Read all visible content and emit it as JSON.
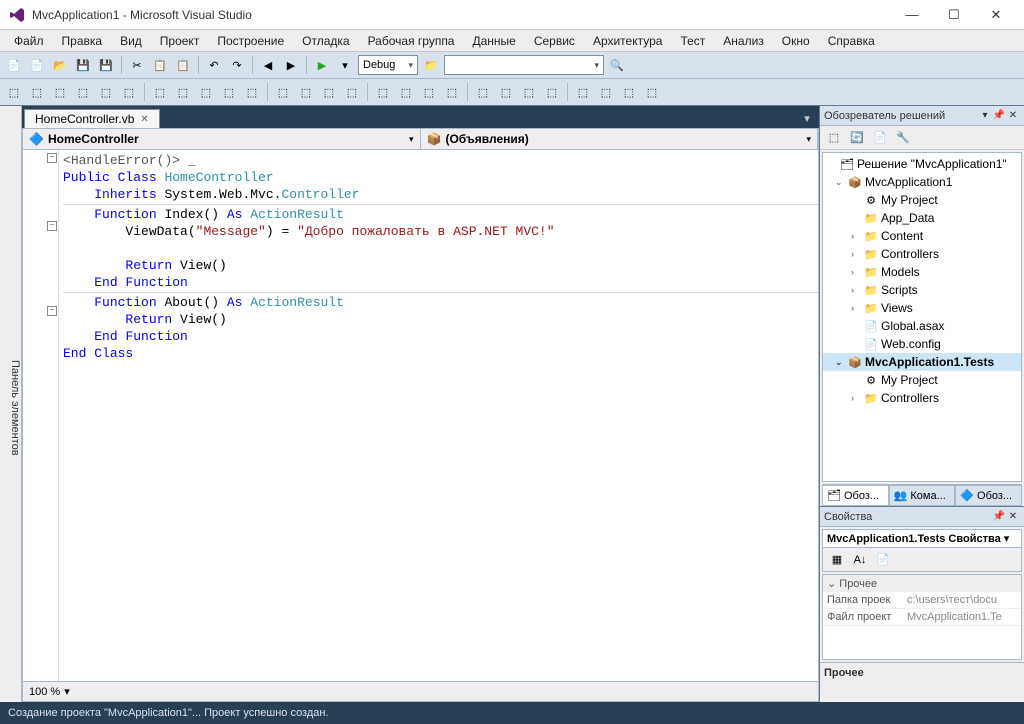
{
  "window": {
    "title": "MvcApplication1 - Microsoft Visual Studio"
  },
  "menu": [
    "Файл",
    "Правка",
    "Вид",
    "Проект",
    "Построение",
    "Отладка",
    "Рабочая группа",
    "Данные",
    "Сервис",
    "Архитектура",
    "Тест",
    "Анализ",
    "Окно",
    "Справка"
  ],
  "toolbar": {
    "config": "Debug"
  },
  "leftPanel": "Панель элементов",
  "editor": {
    "tab": "HomeController.vb",
    "navLeft": "HomeController",
    "navRight": "(Объявления)",
    "zoom": "100 %"
  },
  "code": {
    "l1a": "<",
    "l1b": "HandleError",
    "l1c": "()> _",
    "l2a": "Public",
    "l2b": " ",
    "l2c": "Class",
    "l2d": " ",
    "l2e": "HomeController",
    "l3a": "Inherits",
    "l3b": " System.Web.Mvc.",
    "l3c": "Controller",
    "l4a": "Function",
    "l4b": " Index() ",
    "l4c": "As",
    "l4d": " ",
    "l4e": "ActionResult",
    "l5a": "ViewData(",
    "l5b": "\"Message\"",
    "l5c": ") = ",
    "l5d": "\"Добро пожаловать в ASP.NET MVC!\"",
    "l6a": "Return",
    "l6b": " View()",
    "l7a": "End",
    "l7b": " ",
    "l7c": "Function",
    "l8a": "Function",
    "l8b": " About() ",
    "l8c": "As",
    "l8d": " ",
    "l8e": "ActionResult",
    "l9a": "Return",
    "l9b": " View()",
    "l10a": "End",
    "l10b": " ",
    "l10c": "Function",
    "l11a": "End",
    "l11b": " ",
    "l11c": "Class"
  },
  "solution": {
    "title": "Обозреватель решений",
    "root": "Решение \"MvcApplication1\"",
    "items": [
      "MvcApplication1",
      "My Project",
      "App_Data",
      "Content",
      "Controllers",
      "Models",
      "Scripts",
      "Views",
      "Global.asax",
      "Web.config",
      "MvcApplication1.Tests",
      "My Project",
      "Controllers"
    ],
    "tabs": [
      "Обоз...",
      "Кома...",
      "Обоз..."
    ]
  },
  "props": {
    "title": "Свойства",
    "obj": "MvcApplication1.Tests Свойства",
    "cat": "Прочее",
    "r1k": "Папка проек",
    "r1v": "c:\\users\\тест\\docu",
    "r2k": "Файл проект",
    "r2v": "MvcApplication1.Te",
    "desc": "Прочее"
  },
  "status": "Создание проекта \"MvcApplication1\"... Проект успешно создан."
}
